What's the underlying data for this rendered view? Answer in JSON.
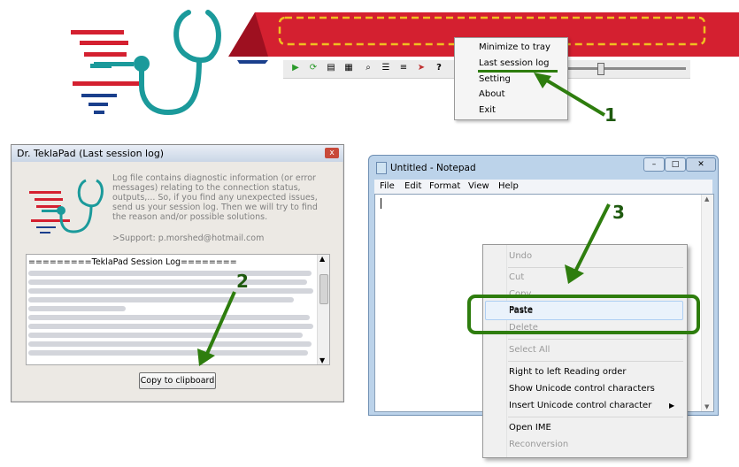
{
  "tray_menu": {
    "items": [
      {
        "label": "Minimize to tray"
      },
      {
        "label": "Last session log"
      },
      {
        "label": "Setting"
      },
      {
        "label": "About"
      },
      {
        "label": "Exit"
      }
    ]
  },
  "steps": {
    "one": "1",
    "two": "2",
    "three": "3"
  },
  "dialog": {
    "title": "Dr. TeklaPad (Last session log)",
    "close_glyph": "x",
    "info": "Log file contains diagnostic information (or error messages) relating to the connection status, outputs,... So, if you find any unexpected issues, send us your session log. Then we will try to find the reason and/or possible solutions.",
    "support": ">Support: p.morshed@hotmail.com",
    "log_header": "=========TeklaPad Session Log========",
    "copy_button": "Copy to clipboard"
  },
  "notepad": {
    "title": "Untitled - Notepad",
    "menus": [
      "File",
      "Edit",
      "Format",
      "View",
      "Help"
    ]
  },
  "context_menu": {
    "items": [
      {
        "label": "Undo",
        "enabled": false
      },
      {
        "label": "Cut",
        "enabled": false
      },
      {
        "label": "Copy",
        "enabled": false
      },
      {
        "label": "Paste",
        "enabled": true
      },
      {
        "label": "Delete",
        "enabled": false
      },
      {
        "label": "Select All",
        "enabled": false
      },
      {
        "label": "Right to left Reading order",
        "enabled": true
      },
      {
        "label": "Show Unicode control characters",
        "enabled": true
      },
      {
        "label": "Insert Unicode control character",
        "enabled": true,
        "submenu": true
      },
      {
        "label": "Open IME",
        "enabled": true
      },
      {
        "label": "Reconversion",
        "enabled": false
      }
    ]
  },
  "colors": {
    "brand_red": "#d42030",
    "brand_blue": "#1a3f8c",
    "stetho_teal": "#1b9a9b",
    "highlight_green": "#2e7d0e",
    "dash_yellow": "#f0c020"
  }
}
